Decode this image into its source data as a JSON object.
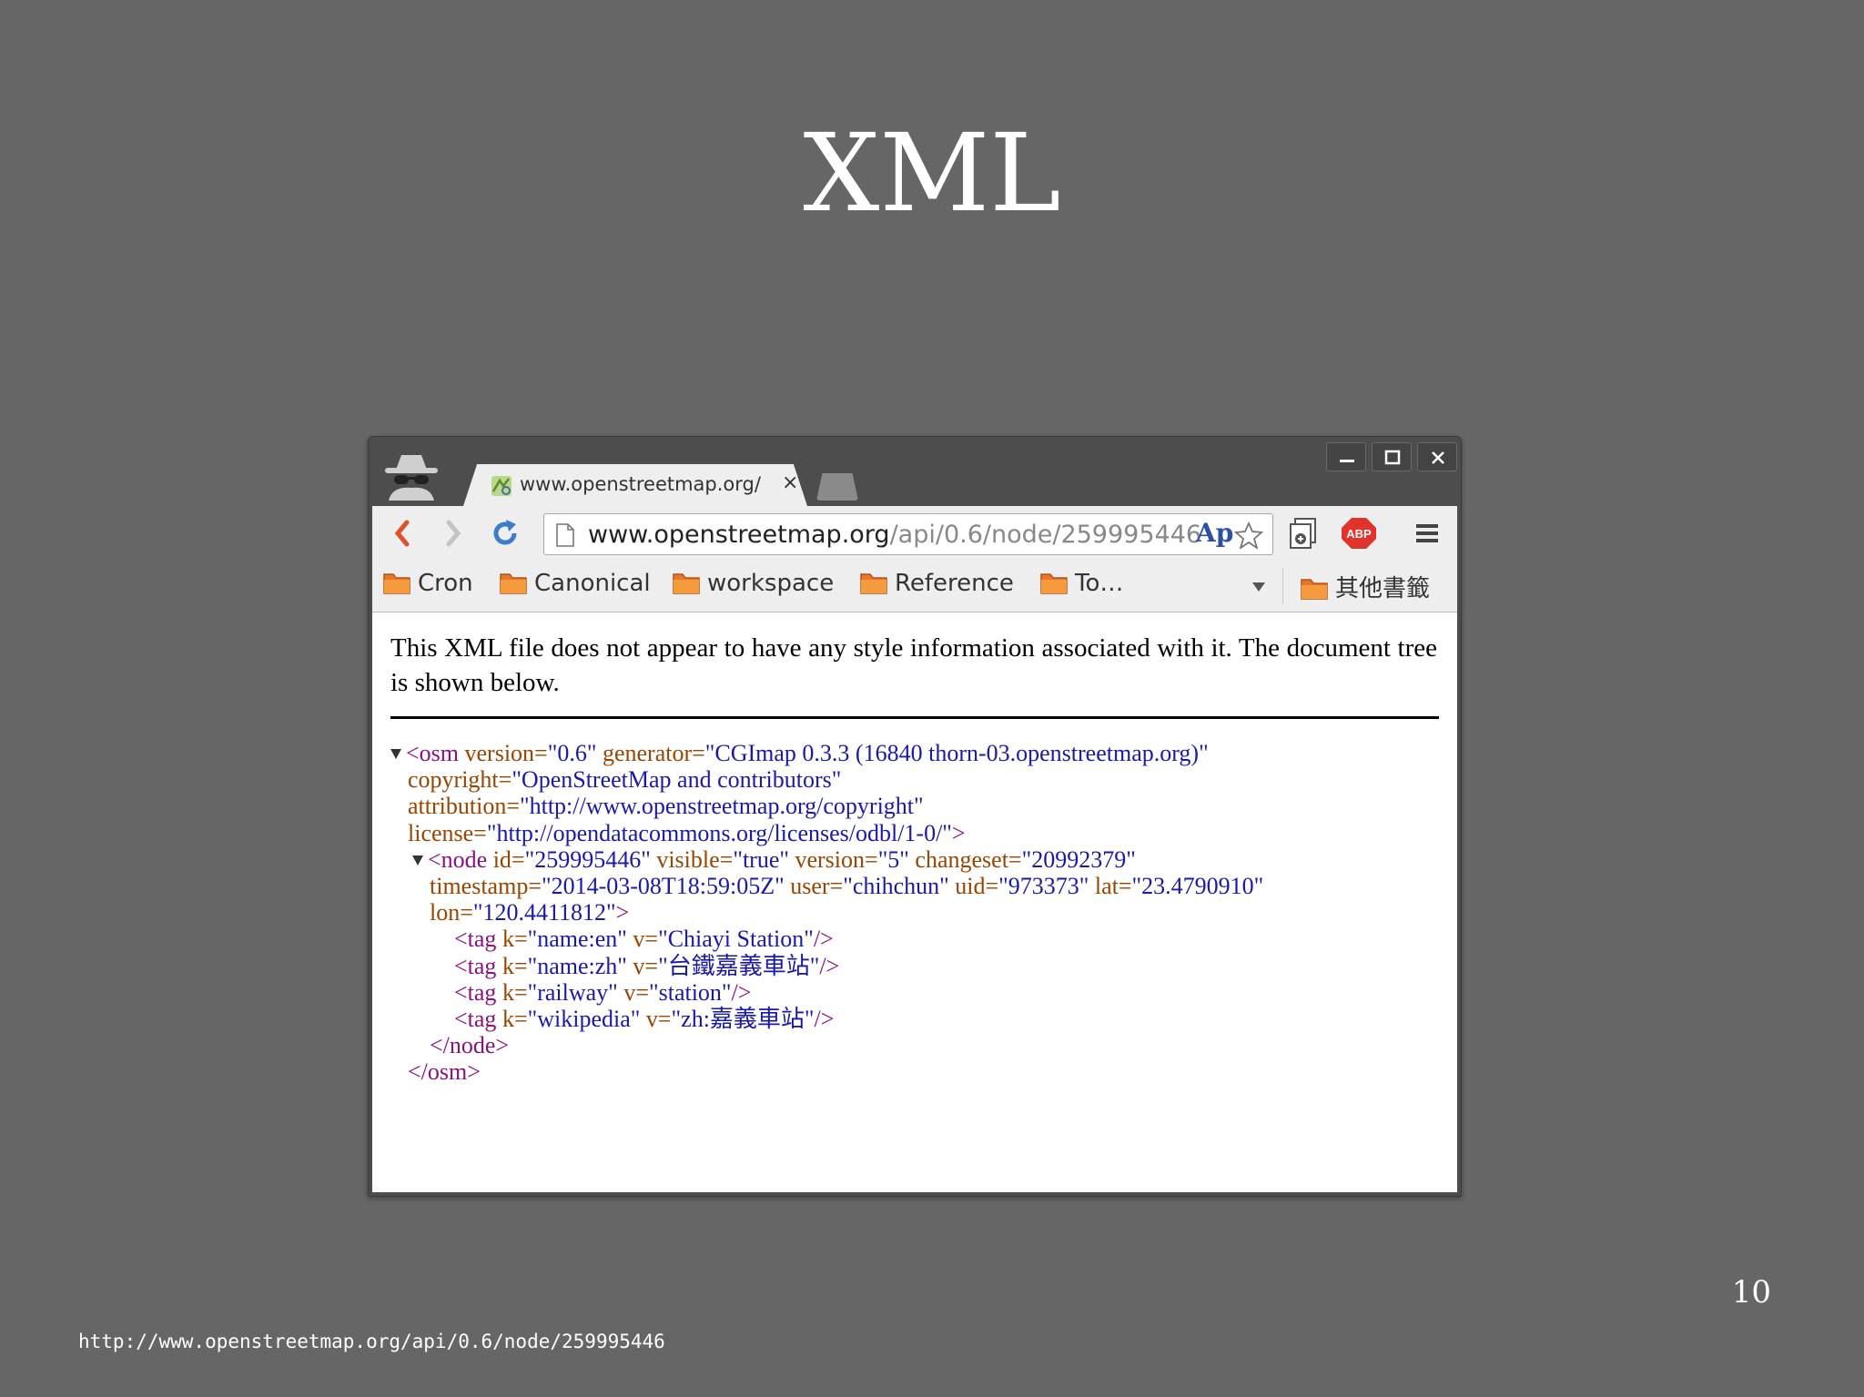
{
  "slide": {
    "title": "XML",
    "page_number": "10",
    "source_url": "http://www.openstreetmap.org/api/0.6/node/259995446"
  },
  "browser": {
    "tab": {
      "title": "www.openstreetmap.org/",
      "close": "×",
      "favicon": "osm-favicon"
    },
    "window_controls": [
      "minimize-icon",
      "maximize-icon",
      "close-icon"
    ],
    "address_bar": {
      "domain": "www.openstreetmap.org",
      "path": "/api/0.6/node/259995446",
      "ext_label": "Ap"
    },
    "toolbar_icons": [
      "back-icon",
      "forward-icon",
      "reload-icon",
      "bookmark-star-icon",
      "page-action-icon",
      "adblock-icon",
      "menu-icon"
    ],
    "adblock_label": "ABP",
    "bookmarks": [
      "Cron",
      "Canonical",
      "workspace",
      "Reference",
      "To…"
    ],
    "other_bookmarks": "其他書籤"
  },
  "document": {
    "notice": "This XML file does not appear to have any style information associated with it. The document tree is shown below.",
    "xml": {
      "l1": [
        "<osm",
        " version=",
        "\"0.6\"",
        " generator=",
        "\"CGImap 0.3.3 (16840 thorn-03.openstreetmap.org)\""
      ],
      "l2": [
        "copyright=",
        "\"OpenStreetMap and contributors\""
      ],
      "l3": [
        "attribution=",
        "\"http://www.openstreetmap.org/copyright\""
      ],
      "l4": [
        "license=",
        "\"http://opendatacommons.org/licenses/odbl/1-0/\"",
        ">"
      ],
      "l5": [
        "<node",
        " id=",
        "\"259995446\"",
        " visible=",
        "\"true\"",
        " version=",
        "\"5\"",
        " changeset=",
        "\"20992379\""
      ],
      "l6": [
        "timestamp=",
        "\"2014-03-08T18:59:05Z\"",
        " user=",
        "\"chihchun\"",
        " uid=",
        "\"973373\"",
        " lat=",
        "\"23.4790910\""
      ],
      "l7": [
        "lon=",
        "\"120.4411812\"",
        ">"
      ],
      "l8": [
        "<tag",
        " k=",
        "\"name:en\"",
        " v=",
        "\"Chiayi Station\"",
        "/>"
      ],
      "l9": [
        "<tag",
        " k=",
        "\"name:zh\"",
        " v=",
        "\"台鐵嘉義車站\"",
        "/>"
      ],
      "l10": [
        "<tag",
        " k=",
        "\"railway\"",
        " v=",
        "\"station\"",
        "/>"
      ],
      "l11": [
        "<tag",
        " k=",
        "\"wikipedia\"",
        " v=",
        "\"zh:嘉義車站\"",
        "/>"
      ],
      "l12": [
        "</node>"
      ],
      "l13": [
        "</osm>"
      ]
    }
  },
  "colors": {
    "tag": "#881280",
    "attr_name": "#994500",
    "attr_value": "#1a1aa6",
    "slide_bg": "#666666"
  }
}
